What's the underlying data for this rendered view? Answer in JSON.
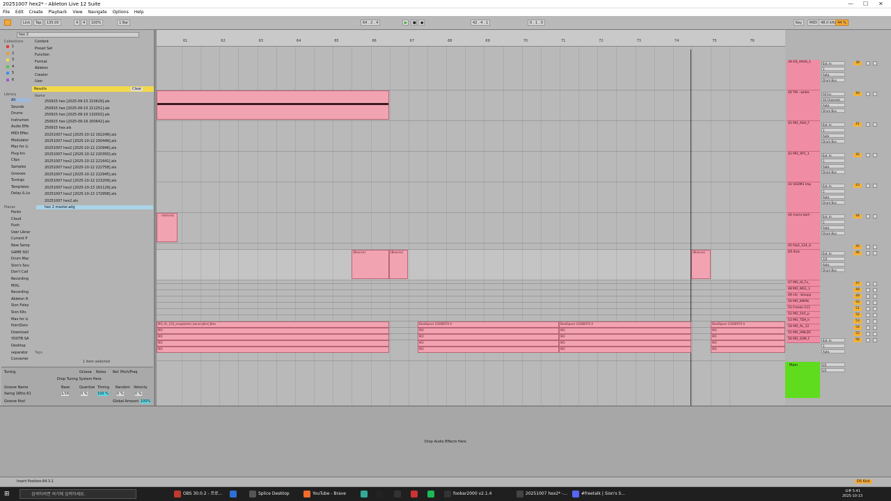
{
  "window": {
    "title": "20251007 hex2* - Ableton Live 12 Suite",
    "controls": [
      "—",
      "☐",
      "✕"
    ]
  },
  "menu": [
    "File",
    "Edit",
    "Create",
    "Playback",
    "View",
    "Navigate",
    "Options",
    "Help"
  ],
  "transport": {
    "link": "Link",
    "tap": "Tap",
    "tempo": "135.00",
    "sig_num": "4",
    "sig_den": "4",
    "zoom": "100%",
    "quant": "1 Bar",
    "position": "64 . 2 . 4",
    "position2": "42 . 4 . 1",
    "loop_len": "0 . 1 . 0",
    "key": "Key",
    "midi": "MIDI",
    "sr": "48.0 kHz",
    "cpu": "44 %"
  },
  "browser": {
    "search": "hex 2",
    "sections": {
      "collections": "Collections",
      "library": "Library",
      "places": "Places"
    },
    "collections": [
      {
        "n": "1",
        "c": "#e8383d"
      },
      {
        "n": "2",
        "c": "#f19b32"
      },
      {
        "n": "3",
        "c": "#efe13a"
      },
      {
        "n": "4",
        "c": "#5ac24b"
      },
      {
        "n": "5",
        "c": "#3f8ef0"
      },
      {
        "n": "6",
        "c": "#9b59d0"
      }
    ],
    "filters": [
      "Content",
      "Preset  Set",
      "Function",
      "Format",
      "Ableton",
      "Creator",
      "User"
    ],
    "library": [
      "All",
      "Sounds",
      "Drums",
      "Instrumen",
      "Audio Effe",
      "MIDI Effec",
      "Modulator",
      "Max for Li",
      "Plug-Ins",
      "Clips",
      "Samples",
      "Grooves",
      "Tunings",
      "Templates",
      "Delay & Lo"
    ],
    "places": [
      "Packs",
      "Cloud",
      "Push",
      "User Librar",
      "Current P",
      "New Samp",
      "GAME SOI",
      "Drum Mac",
      "Sion's Sou",
      "Don't Call",
      "Recording",
      "MIXL",
      "Recording",
      "Ableton R",
      "Sion Foley",
      "Sion Kits",
      "Max for Li",
      "PointZero",
      "Download",
      "YOOTB SA",
      "Desktop",
      "separator",
      "Converter"
    ],
    "results_label": "Results",
    "clear": "Clear",
    "name_col": "Name",
    "files": [
      "250915 hex [2025-09-15 210629].als",
      "250915 hex [2025-09-15 211251].als",
      "250915 hex [2025-09-16 132002].als",
      "250915 hex [2025-09-16 200642].als",
      "250915 hex.als",
      "20251007 hex2 [2025-10-12 162249].als",
      "20251007 hex2 [2025-10-12 200449].als",
      "20251007 hex2 [2025-10-12 210946].als",
      "20251007 hex2 [2025-10-12 220350].als",
      "20251007 hex2 [2025-10-12 221641].als",
      "20251007 hex2 [2025-10-12 222758].als",
      "20251007 hex2 [2025-10-12 222945].als",
      "20251007 hex2 [2025-10-12 223209].als",
      "20251007 hex2 [2025-10-13 161129].als",
      "20251007 hex2 [2025-10-13 172958].als",
      "20251007 hex2.als",
      "hex 2 master.adg"
    ],
    "tags": "Tags",
    "selected": "1 item selected",
    "tuning": {
      "label": "Tuning",
      "octave": "Octave",
      "notes": "Notes",
      "ref": "Ref. Pitch/Freq",
      "drop": "Drop Tuning System Here"
    },
    "groove": {
      "name_col": "Groove Name",
      "base": "Base",
      "quantize": "Quantize",
      "timing": "Timing",
      "random": "Random",
      "velocity": "Velocity",
      "name": "Swing 16ths 61",
      "base_v": "1/16",
      "quant_v": "0 %",
      "timing_v": "100 %",
      "random_v": "0 %",
      "vel_v": "0 %",
      "pool": "Groove Pool",
      "global": "Global Amount",
      "global_v": "100%"
    }
  },
  "ruler": {
    "bars": [
      "61",
      "62",
      "63",
      "64",
      "65",
      "66",
      "67",
      "68",
      "69",
      "70",
      "71",
      "72",
      "73",
      "74",
      "75",
      "76"
    ],
    "times": [
      "1:28",
      "1:30",
      "1:32",
      "1:34",
      "1:36",
      "1:38",
      "1:40",
      "1:42",
      "1:44",
      "1:46",
      "1:48",
      "1:50",
      "1:52",
      "1:54",
      "1:56"
    ]
  },
  "clips": {
    "bounce": "(Bounce)",
    "mario": "... mario-ka",
    "ms": "MO_AL_124_songstarter_bouncybird_8ms",
    "beat": "BeatSpace 10280970 A",
    "mo": "MO"
  },
  "tracks": [
    {
      "num": "39",
      "name": "39 OS_VAHS_1",
      "in": "Ext. In",
      "ch": "1",
      "mon": "Auto",
      "bus": "Drum Bus"
    },
    {
      "num": "40",
      "name": "40 TM - white",
      "in": "All Ins",
      "ch": "All Channels",
      "mon": "Auto",
      "bus": "Drum Bus"
    },
    {
      "num": "41",
      "name": "41 MO_ASH_F",
      "in": "Ext. In",
      "ch": "1",
      "mon": "Auto",
      "bus": "Drum Bus"
    },
    {
      "num": "42",
      "name": "42 MO_XP1_1",
      "in": "Ext. In",
      "ch": "1",
      "mon": "Auto",
      "bus": "Drum Bus"
    },
    {
      "num": "43",
      "name": "43 VEDM3 Imp",
      "in": "Ext. In",
      "ch": "1",
      "mon": "Auto",
      "bus": "Drum Bus"
    },
    {
      "num": "44",
      "name": "44 mario-kart-",
      "in": "Ext. In",
      "ch": "1",
      "mon": "Auto",
      "bus": "Drum Bus"
    },
    {
      "num": "45",
      "name": "45 fsb2_124_d"
    },
    {
      "num": "46",
      "name": "D5 Kick",
      "in": "Ext. In",
      "ch": "1/2",
      "mon": "Auto",
      "bus": "Drum Bus"
    },
    {
      "num": "47",
      "name": "47 MO_HI_Fx_"
    },
    {
      "num": "48",
      "name": "48 MO_WS1_1"
    },
    {
      "num": "49",
      "name": "49 sfx - bloopy"
    },
    {
      "num": "50",
      "name": "50 MO_KMOK"
    },
    {
      "num": "51",
      "name": "51 Freeze 111"
    },
    {
      "num": "52",
      "name": "52 MO_5V2_p"
    },
    {
      "num": "53",
      "name": "53 MO_TDA_h"
    },
    {
      "num": "54",
      "name": "54 MO_AL_12"
    },
    {
      "num": "55",
      "name": "55 MO_HMLD5"
    },
    {
      "num": "56",
      "name": "56 MO_SXM_F",
      "in": "Ext. In",
      "ch": "1",
      "mon": "Auto"
    }
  ],
  "main": {
    "name": "Main",
    "out1": "1/2",
    "out2": "1/2"
  },
  "detail": {
    "drop": "Drop Audio Effects Here"
  },
  "status": {
    "text": "Insert Position:64.3.1",
    "track": "D5 Kick"
  },
  "taskbar": {
    "search": "검색하려면 여기에 입력하세요.",
    "apps": [
      "OBS 30.0.2 - 프로...",
      "",
      "Splice Desktop",
      "YouTube - Brave",
      "",
      "",
      "",
      "",
      "",
      "foobar2000 v2.1.4",
      "20251007 hex2* -...",
      "#freetalk | Sion's S..."
    ],
    "time": "오후 5:41",
    "date": "2025-10-13"
  },
  "colors": {
    "clip": "#f2a3b1",
    "track": "#f08ca4",
    "main": "#5fdc1e",
    "accent": "#f3a93a",
    "play": "#19a51c"
  }
}
